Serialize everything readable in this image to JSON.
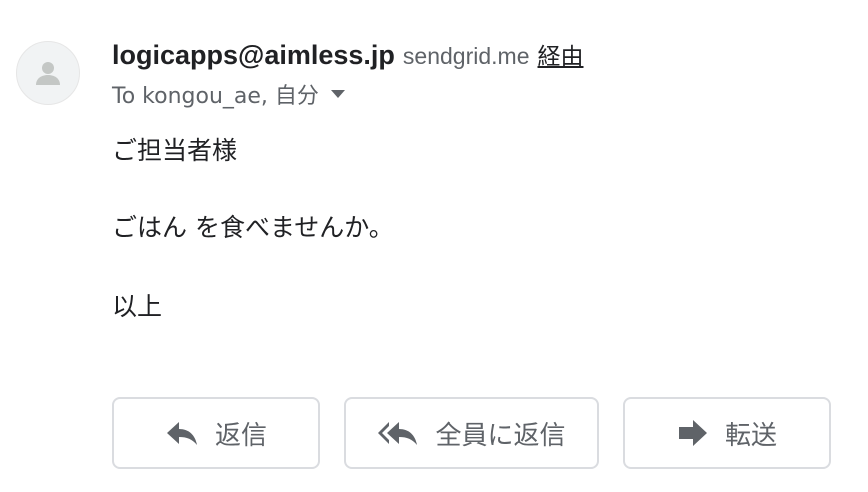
{
  "message": {
    "sender": {
      "email": "logicapps@aimless.jp",
      "via_domain": "sendgrid.me",
      "via_label": "経由"
    },
    "recipient": {
      "text": "To kongou_ae, 自分"
    },
    "body": {
      "greeting": "ご担当者様",
      "content": "ごはん を食べませんか。",
      "closing": "以上"
    }
  },
  "actions": {
    "reply_label": "返信",
    "reply_all_label": "全員に返信",
    "forward_label": "転送"
  },
  "icons": {
    "avatar": "person-icon",
    "recipient_details": "caret-down-icon",
    "reply": "reply-arrow-icon",
    "reply_all": "reply-all-arrow-icon",
    "forward": "forward-arrow-icon"
  },
  "colors": {
    "primary_text": "#202124",
    "secondary_text": "#5f6368",
    "button_border": "#dadce0",
    "avatar_background": "#f1f3f4",
    "avatar_icon": "#c4c7c5"
  }
}
